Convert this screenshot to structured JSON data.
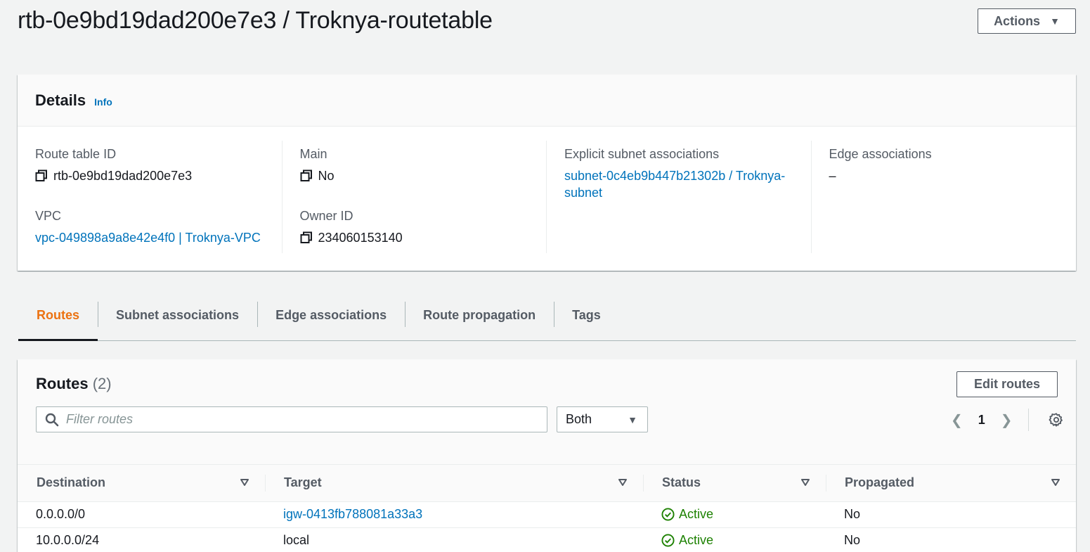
{
  "header": {
    "title": "rtb-0e9bd19dad200e7e3 / Troknya-routetable",
    "actions_label": "Actions"
  },
  "details": {
    "title": "Details",
    "info": "Info",
    "route_table_id_label": "Route table ID",
    "route_table_id": "rtb-0e9bd19dad200e7e3",
    "vpc_label": "VPC",
    "vpc": "vpc-049898a9a8e42e4f0 | Troknya-VPC",
    "main_label": "Main",
    "main": "No",
    "owner_label": "Owner ID",
    "owner": "234060153140",
    "subnet_label": "Explicit subnet associations",
    "subnet_line1": "subnet-0c4eb9b447b21302b / Troknya-",
    "subnet_line2": "subnet",
    "edge_label": "Edge associations",
    "edge": "–"
  },
  "tabs": [
    "Routes",
    "Subnet associations",
    "Edge associations",
    "Route propagation",
    "Tags"
  ],
  "routes": {
    "title": "Routes",
    "count": "(2)",
    "edit_label": "Edit routes",
    "filter_placeholder": "Filter routes",
    "select_value": "Both",
    "page": "1",
    "columns": [
      "Destination",
      "Target",
      "Status",
      "Propagated"
    ],
    "rows": [
      {
        "destination": "0.0.0.0/0",
        "target": "igw-0413fb788081a33a3",
        "status": "Active",
        "propagated": "No"
      },
      {
        "destination": "10.0.0.0/24",
        "target": "local",
        "status": "Active",
        "propagated": "No"
      }
    ]
  },
  "colors": {
    "link": "#0073bb",
    "active_tab": "#ec7211",
    "status_ok": "#1d8102"
  }
}
